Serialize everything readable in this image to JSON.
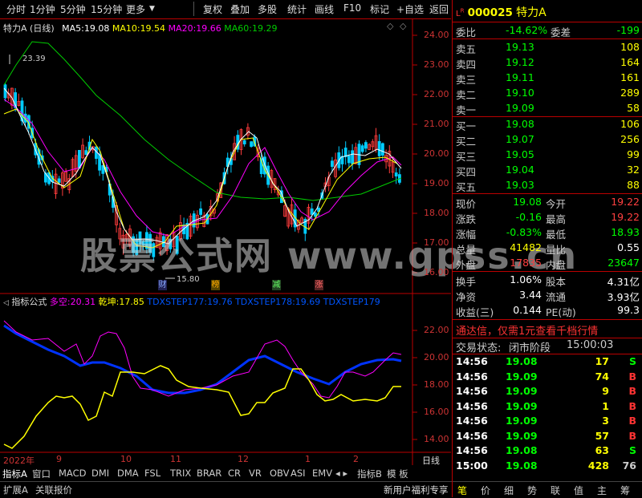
{
  "toolbar": {
    "items": [
      "分时",
      "1分钟",
      "5分钟",
      "15分钟",
      "更多",
      "复权",
      "叠加",
      "多股",
      "统计",
      "画线",
      "F10",
      "标记",
      "+自选",
      "返回"
    ]
  },
  "main_chart": {
    "title": "特力A (日线)",
    "ma": [
      {
        "label": "MA5:",
        "value": "19.08",
        "color": "#ffffff"
      },
      {
        "label": "MA10:",
        "value": "19.54",
        "color": "#ffff00"
      },
      {
        "label": "MA20:",
        "value": "19.66",
        "color": "#ff00ff"
      },
      {
        "label": "MA60:",
        "value": "19.29",
        "color": "#00cc00"
      }
    ],
    "y_ticks": [
      "24.00",
      "23.00",
      "22.00",
      "21.00",
      "20.00",
      "19.00",
      "18.00",
      "17.00",
      "16.00"
    ],
    "high_label": "23.39",
    "low_label": "15.80",
    "markers": [
      "财",
      "榜",
      "减",
      "涨"
    ]
  },
  "indicator": {
    "name": "指标公式",
    "items": [
      {
        "label": "多空:",
        "value": "20.31",
        "color": "#ff00ff"
      },
      {
        "label": "乾坤:",
        "value": "17.85",
        "color": "#ffff00"
      },
      {
        "label": "TDXSTEP177:",
        "value": "19.76",
        "color": "#0044ff"
      },
      {
        "label": "TDXSTEP178:",
        "value": "19.69",
        "color": "#0044ff"
      },
      {
        "label": "TDXSTEP179",
        "value": "",
        "color": "#0044ff"
      }
    ],
    "y_ticks": [
      "22.00",
      "20.00",
      "18.00",
      "16.00",
      "14.00"
    ]
  },
  "x_axis": {
    "labels": [
      "2022年",
      "9",
      "10",
      "11",
      "12",
      "1",
      "2"
    ],
    "period": "日线"
  },
  "tabs": [
    "指标A",
    "窗口",
    "MACD",
    "DMI",
    "DMA",
    "FSL",
    "TRIX",
    "BRAR",
    "CR",
    "VR",
    "OBV",
    "ASI",
    "EMV"
  ],
  "tabs_right": [
    "指标B",
    "模 板"
  ],
  "bottom": {
    "left": [
      "扩展A",
      "关联报价"
    ],
    "promo": "新用户福利专享",
    "right": [
      "笔",
      "价",
      "细",
      "势",
      "联",
      "值",
      "主",
      "筹"
    ]
  },
  "watermark": "股票公式网 www.gpss.cn",
  "quote": {
    "code": "000025",
    "name": "特力A",
    "weibi": {
      "label": "委比",
      "value": "-14.62%",
      "diff_label": "委差",
      "diff": "-199"
    },
    "asks": [
      {
        "label": "卖五",
        "price": "19.13",
        "vol": "108"
      },
      {
        "label": "卖四",
        "price": "19.12",
        "vol": "164"
      },
      {
        "label": "卖三",
        "price": "19.11",
        "vol": "161"
      },
      {
        "label": "卖二",
        "price": "19.10",
        "vol": "289"
      },
      {
        "label": "卖一",
        "price": "19.09",
        "vol": "58"
      }
    ],
    "bids": [
      {
        "label": "买一",
        "price": "19.08",
        "vol": "106"
      },
      {
        "label": "买二",
        "price": "19.07",
        "vol": "256"
      },
      {
        "label": "买三",
        "price": "19.05",
        "vol": "99"
      },
      {
        "label": "买四",
        "price": "19.04",
        "vol": "32"
      },
      {
        "label": "买五",
        "price": "19.03",
        "vol": "88"
      }
    ],
    "stats": [
      {
        "l1": "现价",
        "v1": "19.08",
        "c1": "#00ff00",
        "l2": "今开",
        "v2": "19.22",
        "c2": "#ff4040"
      },
      {
        "l1": "涨跌",
        "v1": "-0.16",
        "c1": "#00ff00",
        "l2": "最高",
        "v2": "19.22",
        "c2": "#ff4040"
      },
      {
        "l1": "涨幅",
        "v1": "-0.83%",
        "c1": "#00ff00",
        "l2": "最低",
        "v2": "18.93",
        "c2": "#00ff00"
      },
      {
        "l1": "总量",
        "v1": "41482",
        "c1": "#ffff00",
        "l2": "量比",
        "v2": "0.55",
        "c2": "#ffffff"
      },
      {
        "l1": "外盘",
        "v1": "17835",
        "c1": "#ff4040",
        "l2": "内盘",
        "v2": "23647",
        "c2": "#00ff00"
      }
    ],
    "stats2": [
      {
        "l1": "换手",
        "v1": "1.06%",
        "l2": "股本",
        "v2": "4.31亿"
      },
      {
        "l1": "净资",
        "v1": "3.44",
        "l2": "流通",
        "v2": "3.93亿"
      },
      {
        "l1": "收益(三)",
        "v1": "0.144",
        "l2": "PE(动)",
        "v2": "99.3"
      }
    ],
    "notice": "通达信，仅需1元查看千档行情",
    "trade_status_label": "交易状态:",
    "trade_status": "闭市阶段",
    "trade_time": "15:00:03",
    "ticks": [
      {
        "time": "14:56",
        "price": "19.08",
        "pc": "#00ff00",
        "vol": "17",
        "side": "S"
      },
      {
        "time": "14:56",
        "price": "19.09",
        "pc": "#00ff00",
        "vol": "74",
        "side": "B"
      },
      {
        "time": "14:56",
        "price": "19.09",
        "pc": "#00ff00",
        "vol": "9",
        "side": "B"
      },
      {
        "time": "14:56",
        "price": "19.09",
        "pc": "#00ff00",
        "vol": "1",
        "side": "B"
      },
      {
        "time": "14:56",
        "price": "19.09",
        "pc": "#00ff00",
        "vol": "3",
        "side": "B"
      },
      {
        "time": "14:56",
        "price": "19.09",
        "pc": "#00ff00",
        "vol": "57",
        "side": "B"
      },
      {
        "time": "14:56",
        "price": "19.08",
        "pc": "#00ff00",
        "vol": "63",
        "side": "S"
      },
      {
        "time": "15:00",
        "price": "19.08",
        "pc": "#00ff00",
        "vol": "428",
        "side": "76"
      }
    ]
  }
}
